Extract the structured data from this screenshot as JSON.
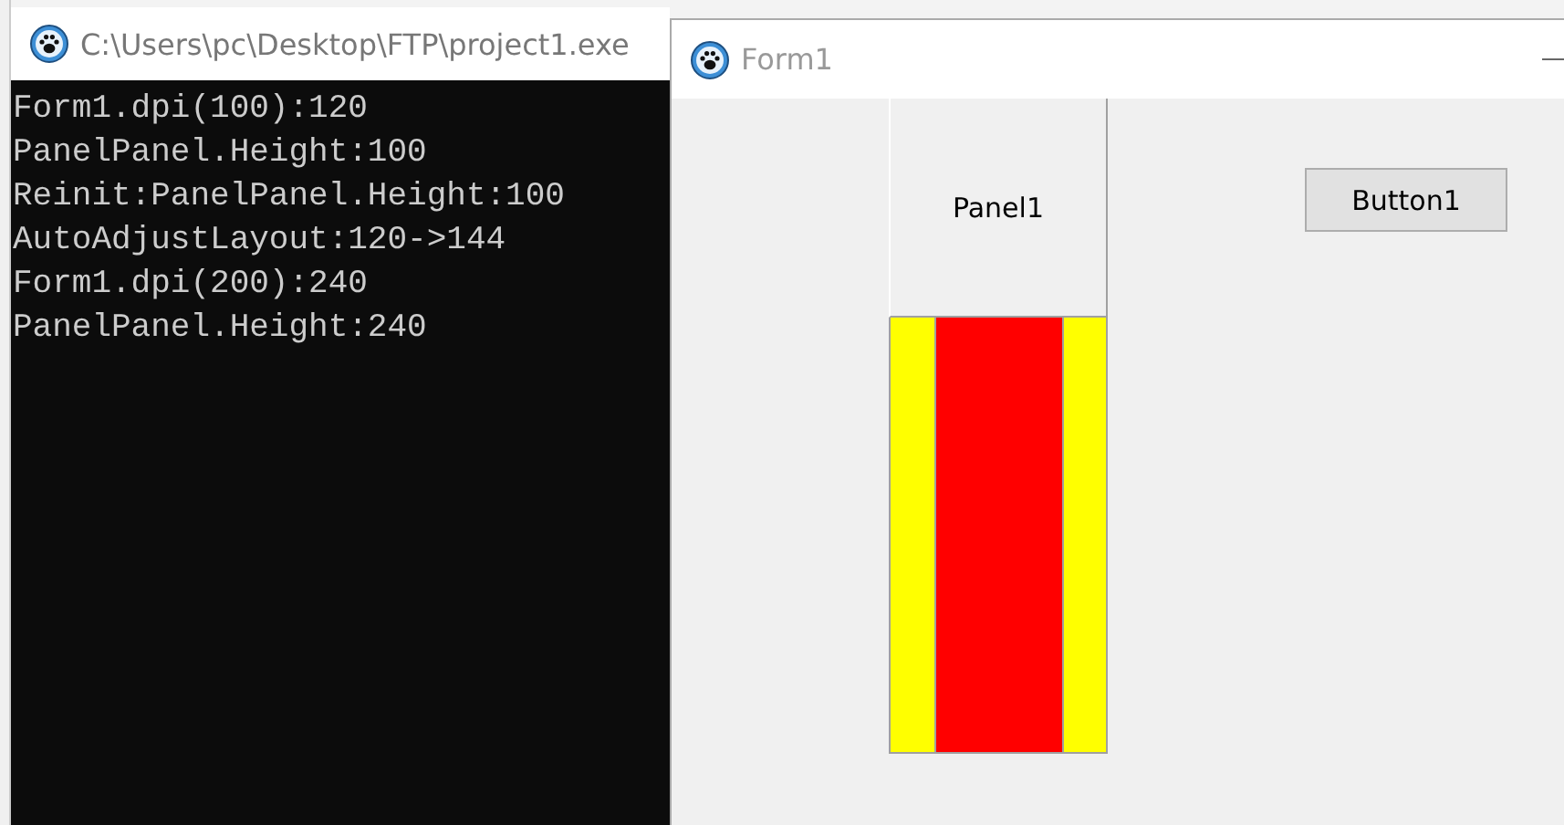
{
  "console": {
    "title": "C:\\Users\\pc\\Desktop\\FTP\\project1.exe",
    "lines": [
      "Form1.dpi(100):120",
      "PanelPanel.Height:100",
      "Reinit:PanelPanel.Height:100",
      "AutoAdjustLayout:120->144",
      "Form1.dpi(200):240",
      "PanelPanel.Height:240"
    ]
  },
  "form": {
    "title": "Form1",
    "panel": {
      "caption": "Panel1"
    },
    "button": {
      "label": "Button1"
    }
  }
}
